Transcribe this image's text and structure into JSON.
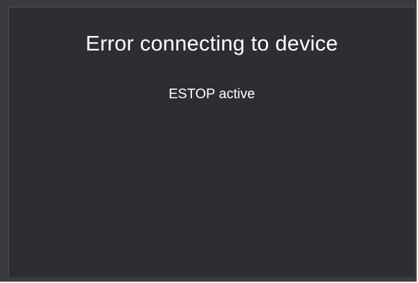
{
  "error_dialog": {
    "title": "Error connecting to device",
    "message": "ESTOP active"
  },
  "colors": {
    "panel_background": "#2d2d33",
    "frame_background": "#3a3a3f",
    "text": "#ffffff"
  }
}
